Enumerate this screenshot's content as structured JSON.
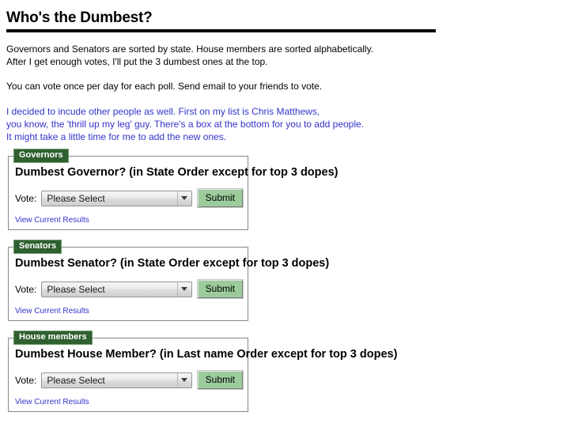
{
  "header": {
    "title": "Who's the Dumbest?"
  },
  "intro": {
    "paragraph1_line1": "Governors and Senators are sorted by state. House members are sorted alphabetically.",
    "paragraph1_line2": "After I get enough votes, I'll put the 3 dumbest ones at the top.",
    "paragraph2": "You can vote once per day for each poll. Send email to your friends to vote.",
    "paragraph3_line1": "I decided to incude other people as well. First on my list is Chris Matthews,",
    "paragraph3_line2": "you know, the 'thrill up my leg' guy. There's a box at the bottom for you to add people.",
    "paragraph3_line3": "It might take a little time for me to add the new ones."
  },
  "colors": {
    "legend_background": "#2f6030",
    "legend_border": "#6f9a6f",
    "submit_background": "#9ccb9c",
    "link": "#3333cc",
    "blue_text": "#3333cc",
    "fieldset_border": "#888888",
    "rule": "#000000"
  },
  "polls": [
    {
      "legend": "Governors",
      "heading": "Dumbest Governor? (in State Order except for top 3 dopes)",
      "vote_label": "Vote:",
      "select_value": "Please Select",
      "select_placeholder": "Please Select",
      "select_options": [
        "Please Select"
      ],
      "submit_label": "Submit",
      "results_link": "View Current Results"
    },
    {
      "legend": "Senators",
      "heading": "Dumbest Senator? (in State Order except for top 3 dopes)",
      "vote_label": "Vote:",
      "select_value": "Please Select",
      "select_placeholder": "Please Select",
      "select_options": [
        "Please Select"
      ],
      "submit_label": "Submit",
      "results_link": "View Current Results"
    },
    {
      "legend": "House members",
      "heading": "Dumbest House Member? (in Last name Order except for top 3 dopes)",
      "vote_label": "Vote:",
      "select_value": "Please Select",
      "select_placeholder": "Please Select",
      "select_options": [
        "Please Select"
      ],
      "submit_label": "Submit",
      "results_link": "View Current Results"
    }
  ]
}
